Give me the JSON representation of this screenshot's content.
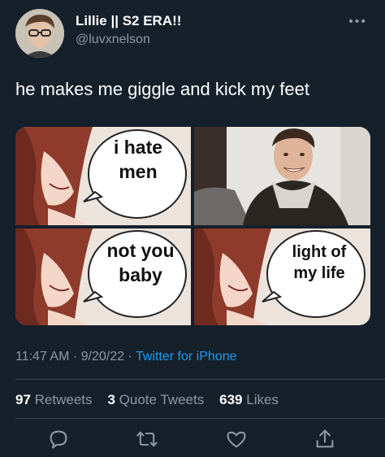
{
  "author": {
    "display_name": "Lillie || S2 ERA!!",
    "handle": "@luvxnelson"
  },
  "tweet": {
    "text": "he makes me giggle and kick my feet",
    "time": "11:47 AM",
    "date": "9/20/22",
    "separator": "·",
    "source": "Twitter for iPhone"
  },
  "meme": {
    "panel1": [
      "i hate",
      "men"
    ],
    "panel3": [
      "not you",
      "baby"
    ],
    "panel4": [
      "light of",
      "my life"
    ]
  },
  "stats": {
    "retweets_count": "97",
    "retweets_label": "Retweets",
    "quotes_count": "3",
    "quotes_label": "Quote Tweets",
    "likes_count": "639",
    "likes_label": "Likes"
  },
  "icons": {
    "more": "more-dots-icon",
    "reply": "reply-icon",
    "retweet": "retweet-icon",
    "like": "heart-icon",
    "share": "share-icon"
  },
  "colors": {
    "background": "#15202b",
    "accent": "#1d9bf0",
    "muted": "#8b98a5",
    "divider": "#38444d"
  }
}
